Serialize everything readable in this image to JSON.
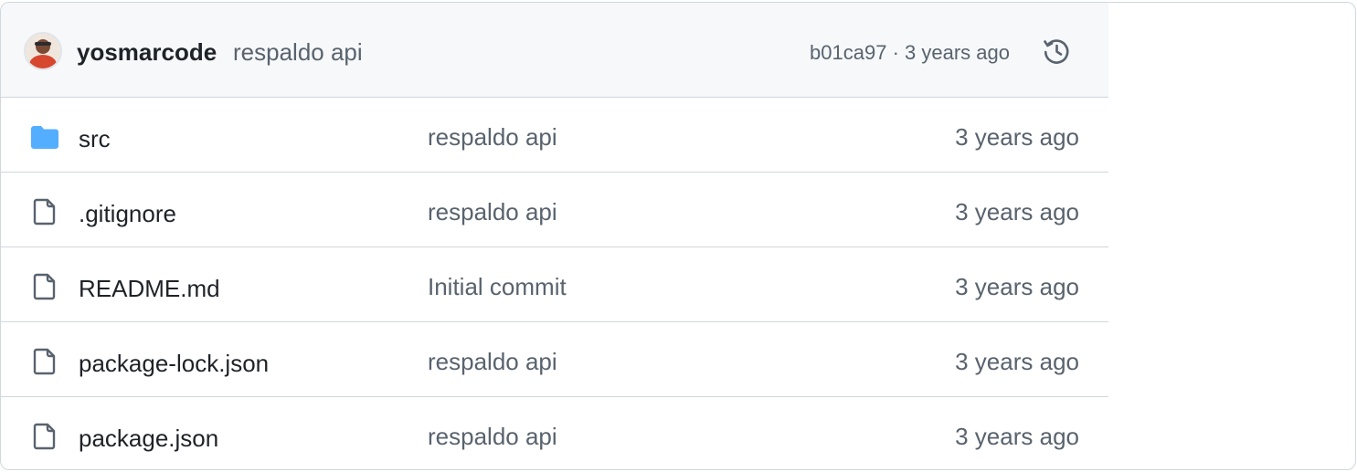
{
  "latest_commit": {
    "author": "yosmarcode",
    "message": "respaldo api",
    "hash": "b01ca97",
    "separator": " · ",
    "age": "3 years ago",
    "history_icon": "history-icon",
    "avatar_icon": "avatar"
  },
  "files": [
    {
      "type": "folder",
      "icon": "folder-icon",
      "name": "src",
      "commit_message": "respaldo api",
      "age": "3 years ago"
    },
    {
      "type": "file",
      "icon": "file-icon",
      "name": ".gitignore",
      "commit_message": "respaldo api",
      "age": "3 years ago"
    },
    {
      "type": "file",
      "icon": "file-icon",
      "name": "README.md",
      "commit_message": "Initial commit",
      "age": "3 years ago"
    },
    {
      "type": "file",
      "icon": "file-icon",
      "name": "package-lock.json",
      "commit_message": "respaldo api",
      "age": "3 years ago"
    },
    {
      "type": "file",
      "icon": "file-icon",
      "name": "package.json",
      "commit_message": "respaldo api",
      "age": "3 years ago"
    }
  ],
  "colors": {
    "folder": "#54aeff",
    "muted_text": "#59636e",
    "primary_text": "#1f2328",
    "border": "#d0d7de",
    "header_bg": "#f6f8fa"
  }
}
